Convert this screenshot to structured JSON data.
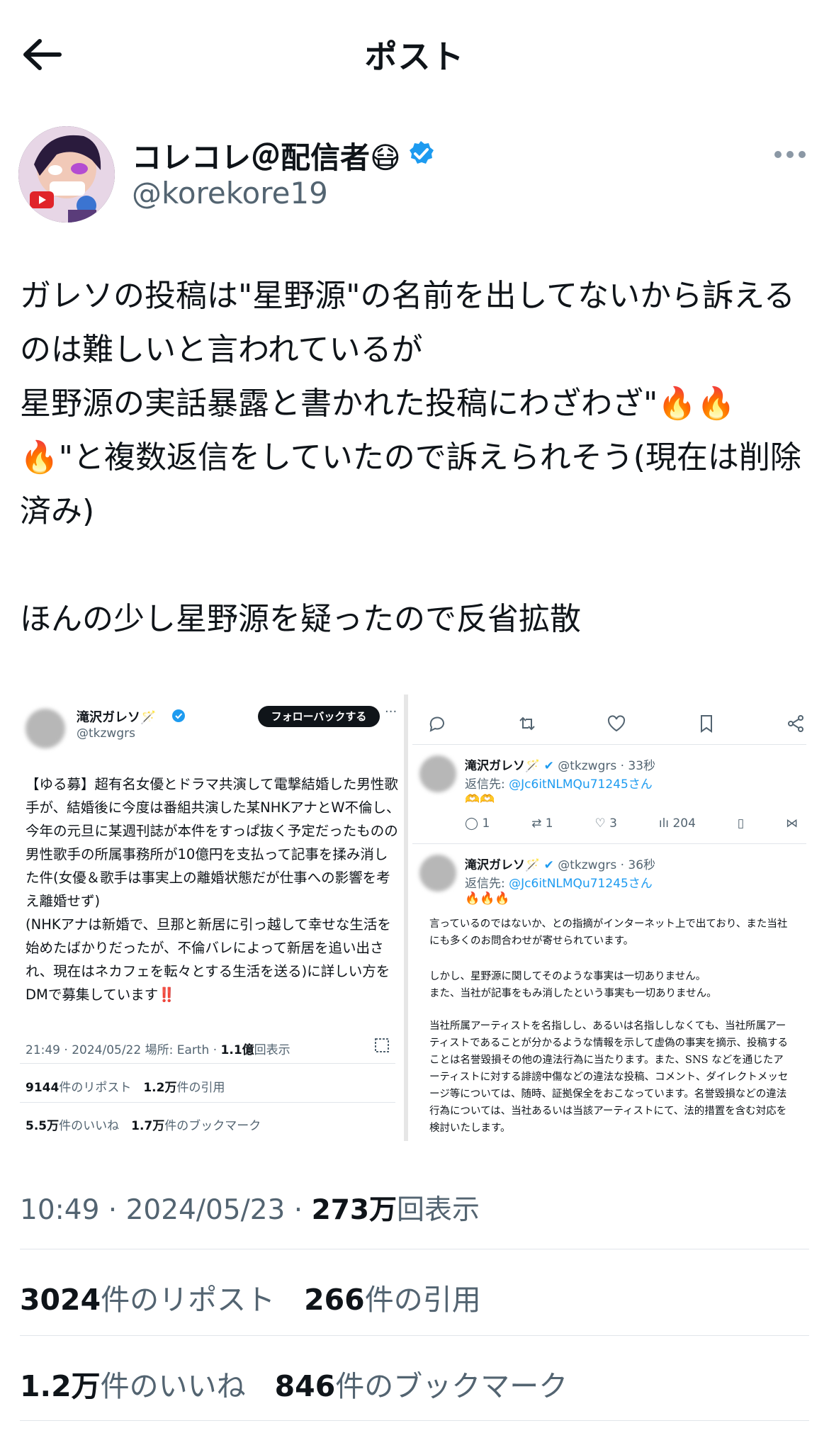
{
  "header": {
    "title": "ポスト"
  },
  "author": {
    "display_name": "コレコレ＠配信者😷",
    "handle": "@korekore19"
  },
  "post": {
    "text": "ガレソの投稿は\"星野源\"の名前を出してないから訴えるのは難しいと言われているが\n星野源の実話暴露と書かれた投稿にわざわざ\"🔥🔥🔥\"と複数返信をしていたので訴えられそう(現在は削除済み)\n\nほんの少し星野源を疑ったので反省拡散"
  },
  "embedded_left": {
    "name": "滝沢ガレソ🪄",
    "handle": "@tkzwgrs",
    "follow_label": "フォローバックする",
    "text": "【ゆる募】超有名女優とドラマ共演して電撃結婚した男性歌手が、結婚後に今度は番組共演した某NHKアナとW不倫し、今年の元旦に某週刊誌が本件をすっぱ抜く予定だったものの男性歌手の所属事務所が10億円を支払って記事を揉み消した件(女優＆歌手は事実上の離婚状態だが仕事への影響を考え離婚せず)\n(NHKアナは新婚で、旦那と新居に引っ越して幸せな生活を始めたばかりだったが、不倫バレによって新居を追い出され、現在はネカフェを転々とする生活を送る)に詳しい方をDMで募集しています‼️",
    "meta_time": "21:49 · 2024/05/22 場所: Earth · ",
    "meta_views": "1.1億",
    "meta_views_suffix": "回表示",
    "reposts": "9144",
    "reposts_label": "件のリポスト",
    "quotes": "1.2万",
    "quotes_label": "件の引用",
    "likes": "5.5万",
    "likes_label": "件のいいね",
    "bookmarks": "1.7万",
    "bookmarks_label": "件のブックマーク"
  },
  "embedded_right": {
    "reply1": {
      "name": "滝沢ガレソ🪄",
      "handle_time": "@tkzwgrs · 33秒",
      "reply_prefix": "返信先: ",
      "reply_to": "@Jc6itNLMQu71245さん",
      "content": "🫶🫶",
      "replies": "1",
      "reposts": "1",
      "likes": "3",
      "views": "204"
    },
    "reply2": {
      "name": "滝沢ガレソ🪄",
      "handle_time": "@tkzwgrs · 36秒",
      "reply_prefix": "返信先: ",
      "reply_to": "@Jc6itNLMQu71245さん",
      "content": "🔥🔥🔥"
    },
    "statement_p1": "言っているのではないか、との指摘がインターネット上で出ており、また当社にも多くのお問合わせが寄せられています。",
    "statement_p2": "しかし、星野源に関してそのような事実は一切ありません。\nまた、当社が記事をもみ消したという事実も一切ありません。",
    "statement_p3": "当社所属アーティストを名指しし、あるいは名指ししなくても、当社所属アーティストであることが分かるような情報を示して虚偽の事実を摘示、投稿することは名誉毀損その他の違法行為に当たります。また、SNS などを通じたアーティストに対する誹謗中傷などの違法な投稿、コメント、ダイレクトメッセージ等については、随時、証拠保全をおこなっています。名誉毀損などの違法行為については、当社あるいは当該アーティストにて、法的措置を含む対応を検討いたします。"
  },
  "meta": {
    "time": "10:49 · 2024/05/23 · ",
    "views": "273万",
    "views_suffix": "回表示"
  },
  "stats": {
    "reposts": "3024",
    "reposts_label": "件のリポスト",
    "quotes": "266",
    "quotes_label": "件の引用",
    "likes": "1.2万",
    "likes_label": "件のいいね",
    "bookmarks": "846",
    "bookmarks_label": "件のブックマーク"
  },
  "colors": {
    "verified": "#1d9bf0",
    "link": "#1d9bf0",
    "muted": "#536471"
  }
}
